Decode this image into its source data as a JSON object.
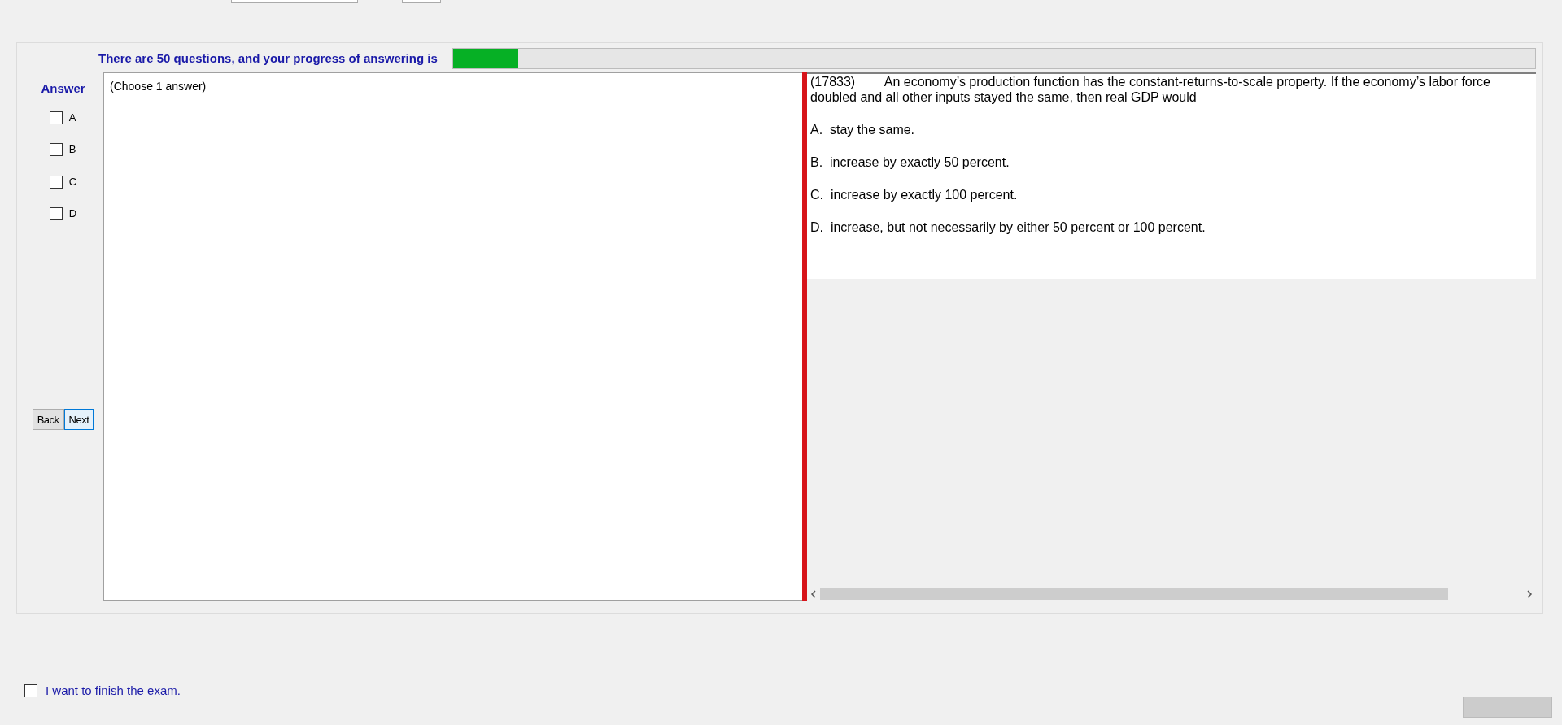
{
  "progress": {
    "label": "There are 50 questions, and your progress of answering is",
    "level": 0.06
  },
  "answer": {
    "title": "Answer",
    "options": [
      {
        "label": "A",
        "checked": false
      },
      {
        "label": "B",
        "checked": false
      },
      {
        "label": "C",
        "checked": false
      },
      {
        "label": "D",
        "checked": false
      }
    ]
  },
  "buttons": [
    {
      "label": "Back",
      "selected": false
    },
    {
      "label": "Next",
      "selected": true
    }
  ],
  "answer_box": {
    "hint": "(Choose 1 answer)"
  },
  "question": {
    "number": "(17833)",
    "text": "An economy’s production function has the constant-returns-to-scale property. If the economy’s labor force doubled and all other inputs stayed the same, then real GDP would",
    "choices": [
      "A.  stay the same.",
      "B.  increase by exactly 50 percent.",
      "C.  increase by exactly 100 percent.",
      "D.  increase, but not necessarily by either 50 percent or 100 percent."
    ]
  },
  "finish": {
    "label": "I want to finish the exam.",
    "checked": false
  }
}
